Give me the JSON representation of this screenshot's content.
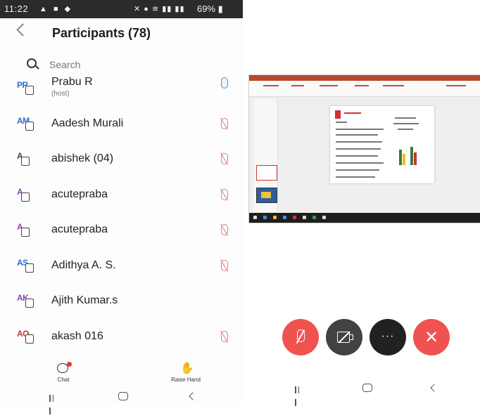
{
  "status_bar": {
    "time": "11:22",
    "battery": "69%",
    "left_icons": [
      "notification-icon",
      "message-icon",
      "shield-icon"
    ],
    "right_icons": [
      "mute-icon",
      "location-icon",
      "wifi-icon",
      "signal-icon",
      "signal-icon"
    ]
  },
  "header": {
    "title": "Participants (78)"
  },
  "search": {
    "placeholder": "Search"
  },
  "participants": [
    {
      "initials": "PR",
      "name": "Prabu R",
      "sub": "(host)",
      "mic": "on",
      "color": "#2a6fd6"
    },
    {
      "initials": "AM",
      "name": "Aadesh Murali",
      "sub": "",
      "mic": "muted",
      "color": "#2a6fd6"
    },
    {
      "initials": "A",
      "name": "abishek (04)",
      "sub": "",
      "mic": "muted",
      "color": "#444444"
    },
    {
      "initials": "A",
      "name": "acutepraba",
      "sub": "",
      "mic": "muted",
      "color": "#8e44ad"
    },
    {
      "initials": "A",
      "name": "acutepraba",
      "sub": "",
      "mic": "muted",
      "color": "#8e44ad"
    },
    {
      "initials": "AS",
      "name": "Adithya A. S.",
      "sub": "",
      "mic": "muted",
      "color": "#2a6fd6"
    },
    {
      "initials": "AK",
      "name": "Ajith Kumar.s",
      "sub": "",
      "mic": "",
      "color": "#8e44ad"
    },
    {
      "initials": "AO",
      "name": "akash 016",
      "sub": "",
      "mic": "muted",
      "color": "#c0392b"
    }
  ],
  "bottom_bar": {
    "chat_label": "Chat",
    "raise_hand_label": "Raise Hand"
  },
  "meeting_controls": {
    "mic_state": "muted",
    "video_state": "off",
    "more_label": "···",
    "end_label": "✕"
  },
  "colors": {
    "accent_red": "#ef5350",
    "dark_button": "#424242",
    "host_mic": "#4a8fd6",
    "muted_mic": "#e27a7a"
  }
}
